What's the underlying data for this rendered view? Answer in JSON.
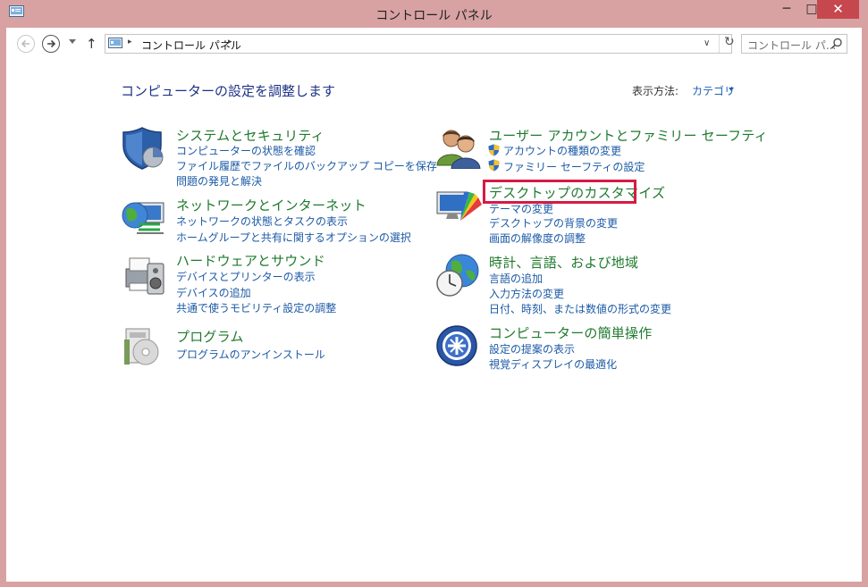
{
  "window": {
    "title": "コントロール パネル",
    "minimize_glyph": "─",
    "maximize_glyph": "□",
    "close_glyph": "✕"
  },
  "nav": {
    "up_glyph": "↑",
    "breadcrumb": "コントロール パネル",
    "crumb_sep": "▸",
    "dropdown_glyph": "∨",
    "refresh_glyph": "↻",
    "search_placeholder": "コントロール パ..."
  },
  "header": {
    "heading": "コンピューターの設定を調整します",
    "view_by_label": "表示方法:",
    "view_by_value": "カテゴリ"
  },
  "categories": [
    {
      "title": "システムとセキュリティ",
      "icon": "security-shield-icon",
      "links": [
        "コンピューターの状態を確認",
        "ファイル履歴でファイルのバックアップ コピーを保存",
        "問題の発見と解決"
      ]
    },
    {
      "title": "ネットワークとインターネット",
      "icon": "network-globe-icon",
      "links": [
        "ネットワークの状態とタスクの表示",
        "ホームグループと共有に関するオプションの選択"
      ]
    },
    {
      "title": "ハードウェアとサウンド",
      "icon": "printer-speaker-icon",
      "links": [
        "デバイスとプリンターの表示",
        "デバイスの追加",
        "共通で使うモビリティ設定の調整"
      ]
    },
    {
      "title": "プログラム",
      "icon": "programs-icon",
      "links": [
        "プログラムのアンインストール"
      ]
    },
    {
      "title": "ユーザー アカウントとファミリー セーフティ",
      "icon": "users-icon",
      "links": [
        "アカウントの種類の変更",
        "ファミリー セーフティの設定"
      ]
    },
    {
      "title": "デスクトップのカスタマイズ",
      "icon": "desktop-color-icon",
      "links": [
        "テーマの変更",
        "デスクトップの背景の変更",
        "画面の解像度の調整"
      ]
    },
    {
      "title": "時計、言語、および地域",
      "icon": "clock-globe-icon",
      "links": [
        "言語の追加",
        "入力方法の変更",
        "日付、時刻、または数値の形式の変更"
      ]
    },
    {
      "title": "コンピューターの簡単操作",
      "icon": "ease-of-access-icon",
      "links": [
        "設定の提案の表示",
        "視覚ディスプレイの最適化"
      ]
    }
  ],
  "colors": {
    "frame": "#d8a2a3",
    "close_button": "#c7474f",
    "category_title": "#1f7a2e",
    "link": "#1c5aa6",
    "heading": "#1e3287",
    "highlight_box": "#d71a44"
  }
}
